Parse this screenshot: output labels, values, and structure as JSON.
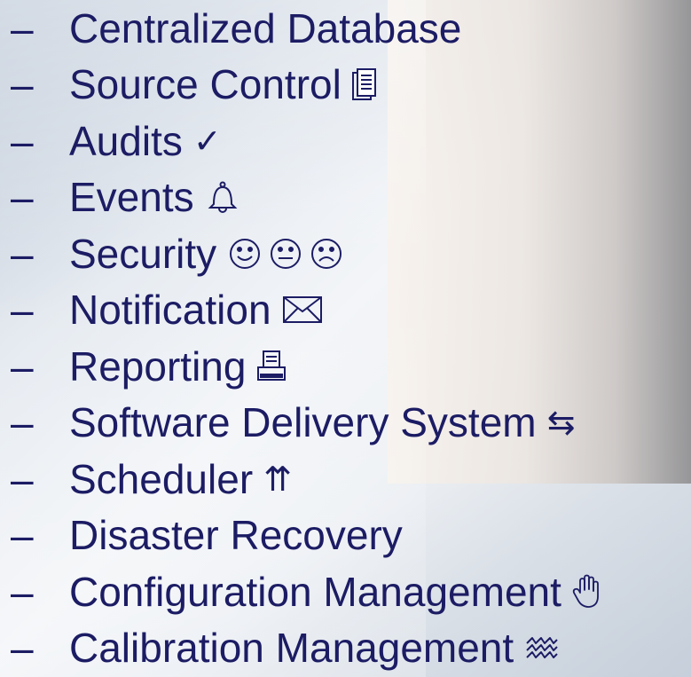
{
  "items": [
    {
      "label": "Centralized Database",
      "icon": "",
      "icon_name": ""
    },
    {
      "label": "Source Control",
      "icon": "",
      "icon_name": "documents-icon"
    },
    {
      "label": "Audits",
      "icon": "✓",
      "icon_name": "checkmark-icon"
    },
    {
      "label": "Events",
      "icon": "",
      "icon_name": "bell-icon"
    },
    {
      "label": "Security",
      "icon": "☺😐☹",
      "icon_name": "faces-icon"
    },
    {
      "label": "Notification",
      "icon": "",
      "icon_name": "envelope-icon"
    },
    {
      "label": "Reporting",
      "icon": "",
      "icon_name": "printer-icon"
    },
    {
      "label": "Software Delivery System",
      "icon": "⇆",
      "icon_name": "exchange-arrows-icon"
    },
    {
      "label": "Scheduler",
      "icon": "⇈",
      "icon_name": "double-up-arrow-icon"
    },
    {
      "label": "Disaster Recovery",
      "icon": "",
      "icon_name": ""
    },
    {
      "label": "Configuration Management",
      "icon": "",
      "icon_name": "hand-icon"
    },
    {
      "label": "Calibration Management",
      "icon": "",
      "icon_name": "wave-icon"
    }
  ],
  "dash": "–",
  "colors": {
    "text": "#1c1c64"
  }
}
